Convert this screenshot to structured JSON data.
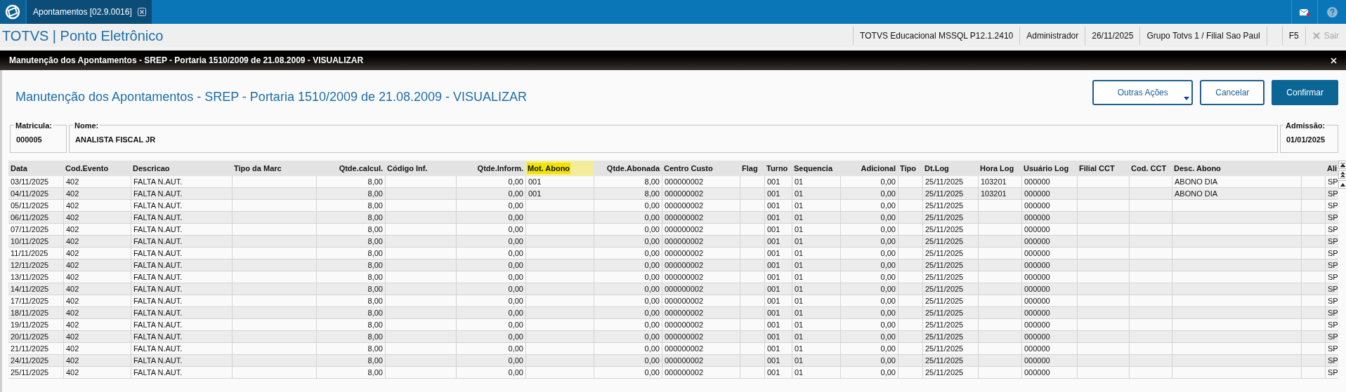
{
  "top_bar": {
    "tab": {
      "label": "Apontamentos [02.9.0016]",
      "selected": true
    }
  },
  "app_bar": {
    "title": "TOTVS | Ponto Eletrônico",
    "info": [
      "TOTVS Educacional MSSQL P12.1.2410",
      "Administrador",
      "26/11/2025",
      "Grupo Totvs 1 / Filial Sao Paul",
      "F5"
    ],
    "exit": {
      "label": "Sair",
      "disabled": true
    }
  },
  "dialog": {
    "title": "Manutenção dos Apontamentos - SREP - Portaria 1510/2009 de 21.08.2009 - VISUALIZAR",
    "heading": "Manutenção dos Apontamentos - SREP - Portaria 1510/2009 de 21.08.2009 - VISUALIZAR",
    "buttons": [
      {
        "label": "Outras Ações",
        "kind": "menu"
      },
      {
        "label": "Cancelar",
        "kind": "outline"
      },
      {
        "label": "Confirmar",
        "kind": "primary"
      }
    ],
    "fields": [
      {
        "label": "Matricula:",
        "value": "000005"
      },
      {
        "label": "Nome:",
        "value": "ANALISTA FISCAL JR"
      },
      {
        "label": "Admissão:",
        "value": "01/01/2025"
      }
    ],
    "table": {
      "columns": [
        {
          "label": "Data",
          "kind": "text",
          "highlighted": false
        },
        {
          "label": "Cod.Evento",
          "kind": "text",
          "highlighted": false
        },
        {
          "label": "Descricao",
          "kind": "text",
          "highlighted": false
        },
        {
          "label": "Tipo da Marc",
          "kind": "text",
          "highlighted": false
        },
        {
          "label": "Qtde.calcul.",
          "kind": "number",
          "highlighted": false
        },
        {
          "label": "Código Inf.",
          "kind": "text",
          "highlighted": false
        },
        {
          "label": "Qtde.Inform.",
          "kind": "number",
          "highlighted": false
        },
        {
          "label": "Mot. Abono",
          "kind": "text",
          "highlighted": true
        },
        {
          "label": "Qtde.Abonada",
          "kind": "number",
          "highlighted": false
        },
        {
          "label": "Centro Custo",
          "kind": "text",
          "highlighted": false
        },
        {
          "label": "Flag",
          "kind": "text",
          "highlighted": false
        },
        {
          "label": "Turno",
          "kind": "text",
          "highlighted": false
        },
        {
          "label": "Sequencia",
          "kind": "text",
          "highlighted": false
        },
        {
          "label": "Adicional",
          "kind": "number",
          "highlighted": false
        },
        {
          "label": "Tipo",
          "kind": "text",
          "highlighted": false
        },
        {
          "label": "Dt.Log",
          "kind": "text",
          "highlighted": false
        },
        {
          "label": "Hora Log",
          "kind": "text",
          "highlighted": false
        },
        {
          "label": "Usuário Log",
          "kind": "text",
          "highlighted": false
        },
        {
          "label": "Filial CCT",
          "kind": "text",
          "highlighted": false
        },
        {
          "label": "Cod. CCT",
          "kind": "text",
          "highlighted": false
        },
        {
          "label": "Desc. Abono",
          "kind": "text",
          "highlighted": false
        },
        {
          "kind": "text"
        },
        {
          "label": "Ali",
          "kind": "text",
          "highlighted": false
        }
      ],
      "rows": [
        [
          "03/11/2025",
          "402",
          "FALTA N.AUT.",
          null,
          "8,00",
          null,
          "0,00",
          "001",
          "8,00",
          "000000002",
          null,
          "001",
          "01",
          "0,00",
          null,
          "25/11/2025",
          "103201",
          "000000",
          null,
          null,
          "ABONO DIA",
          null,
          "SP"
        ],
        [
          "04/11/2025",
          "402",
          "FALTA N.AUT.",
          null,
          "8,00",
          null,
          "0,00",
          "001",
          "8,00",
          "000000002",
          null,
          "001",
          "01",
          "0,00",
          null,
          "25/11/2025",
          "103201",
          "000000",
          null,
          null,
          "ABONO DIA",
          null,
          "SP"
        ],
        [
          "05/11/2025",
          "402",
          "FALTA N.AUT.",
          null,
          "8,00",
          null,
          "0,00",
          null,
          "0,00",
          "000000002",
          null,
          "001",
          "01",
          "0,00",
          null,
          "25/11/2025",
          null,
          "000000",
          null,
          null,
          null,
          null,
          "SP"
        ],
        [
          "06/11/2025",
          "402",
          "FALTA N.AUT.",
          null,
          "8,00",
          null,
          "0,00",
          null,
          "0,00",
          "000000002",
          null,
          "001",
          "01",
          "0,00",
          null,
          "25/11/2025",
          null,
          "000000",
          null,
          null,
          null,
          null,
          "SP"
        ],
        [
          "07/11/2025",
          "402",
          "FALTA N.AUT.",
          null,
          "8,00",
          null,
          "0,00",
          null,
          "0,00",
          "000000002",
          null,
          "001",
          "01",
          "0,00",
          null,
          "25/11/2025",
          null,
          "000000",
          null,
          null,
          null,
          null,
          "SP"
        ],
        [
          "10/11/2025",
          "402",
          "FALTA N.AUT.",
          null,
          "8,00",
          null,
          "0,00",
          null,
          "0,00",
          "000000002",
          null,
          "001",
          "01",
          "0,00",
          null,
          "25/11/2025",
          null,
          "000000",
          null,
          null,
          null,
          null,
          "SP"
        ],
        [
          "11/11/2025",
          "402",
          "FALTA N.AUT.",
          null,
          "8,00",
          null,
          "0,00",
          null,
          "0,00",
          "000000002",
          null,
          "001",
          "01",
          "0,00",
          null,
          "25/11/2025",
          null,
          "000000",
          null,
          null,
          null,
          null,
          "SP"
        ],
        [
          "12/11/2025",
          "402",
          "FALTA N.AUT.",
          null,
          "8,00",
          null,
          "0,00",
          null,
          "0,00",
          "000000002",
          null,
          "001",
          "01",
          "0,00",
          null,
          "25/11/2025",
          null,
          "000000",
          null,
          null,
          null,
          null,
          "SP"
        ],
        [
          "13/11/2025",
          "402",
          "FALTA N.AUT.",
          null,
          "8,00",
          null,
          "0,00",
          null,
          "0,00",
          "000000002",
          null,
          "001",
          "01",
          "0,00",
          null,
          "25/11/2025",
          null,
          "000000",
          null,
          null,
          null,
          null,
          "SP"
        ],
        [
          "14/11/2025",
          "402",
          "FALTA N.AUT.",
          null,
          "8,00",
          null,
          "0,00",
          null,
          "0,00",
          "000000002",
          null,
          "001",
          "01",
          "0,00",
          null,
          "25/11/2025",
          null,
          "000000",
          null,
          null,
          null,
          null,
          "SP"
        ],
        [
          "17/11/2025",
          "402",
          "FALTA N.AUT.",
          null,
          "8,00",
          null,
          "0,00",
          null,
          "0,00",
          "000000002",
          null,
          "001",
          "01",
          "0,00",
          null,
          "25/11/2025",
          null,
          "000000",
          null,
          null,
          null,
          null,
          "SP"
        ],
        [
          "18/11/2025",
          "402",
          "FALTA N.AUT.",
          null,
          "8,00",
          null,
          "0,00",
          null,
          "0,00",
          "000000002",
          null,
          "001",
          "01",
          "0,00",
          null,
          "25/11/2025",
          null,
          "000000",
          null,
          null,
          null,
          null,
          "SP"
        ],
        [
          "19/11/2025",
          "402",
          "FALTA N.AUT.",
          null,
          "8,00",
          null,
          "0,00",
          null,
          "0,00",
          "000000002",
          null,
          "001",
          "01",
          "0,00",
          null,
          "25/11/2025",
          null,
          "000000",
          null,
          null,
          null,
          null,
          "SP"
        ],
        [
          "20/11/2025",
          "402",
          "FALTA N.AUT.",
          null,
          "8,00",
          null,
          "0,00",
          null,
          "0,00",
          "000000002",
          null,
          "001",
          "01",
          "0,00",
          null,
          "25/11/2025",
          null,
          "000000",
          null,
          null,
          null,
          null,
          "SP"
        ],
        [
          "21/11/2025",
          "402",
          "FALTA N.AUT.",
          null,
          "8,00",
          null,
          "0,00",
          null,
          "0,00",
          "000000002",
          null,
          "001",
          "01",
          "0,00",
          null,
          "25/11/2025",
          null,
          "000000",
          null,
          null,
          null,
          null,
          "SP"
        ],
        [
          "24/11/2025",
          "402",
          "FALTA N.AUT.",
          null,
          "8,00",
          null,
          "0,00",
          null,
          "0,00",
          "000000002",
          null,
          "001",
          "01",
          "0,00",
          null,
          "25/11/2025",
          null,
          "000000",
          null,
          null,
          null,
          null,
          "SP"
        ],
        [
          "25/11/2025",
          "402",
          "FALTA N.AUT.",
          null,
          "8,00",
          null,
          "0,00",
          null,
          "0,00",
          "000000002",
          null,
          "001",
          "01",
          "0,00",
          null,
          "25/11/2025",
          null,
          "000000",
          null,
          null,
          null,
          null,
          "SP"
        ]
      ]
    }
  }
}
